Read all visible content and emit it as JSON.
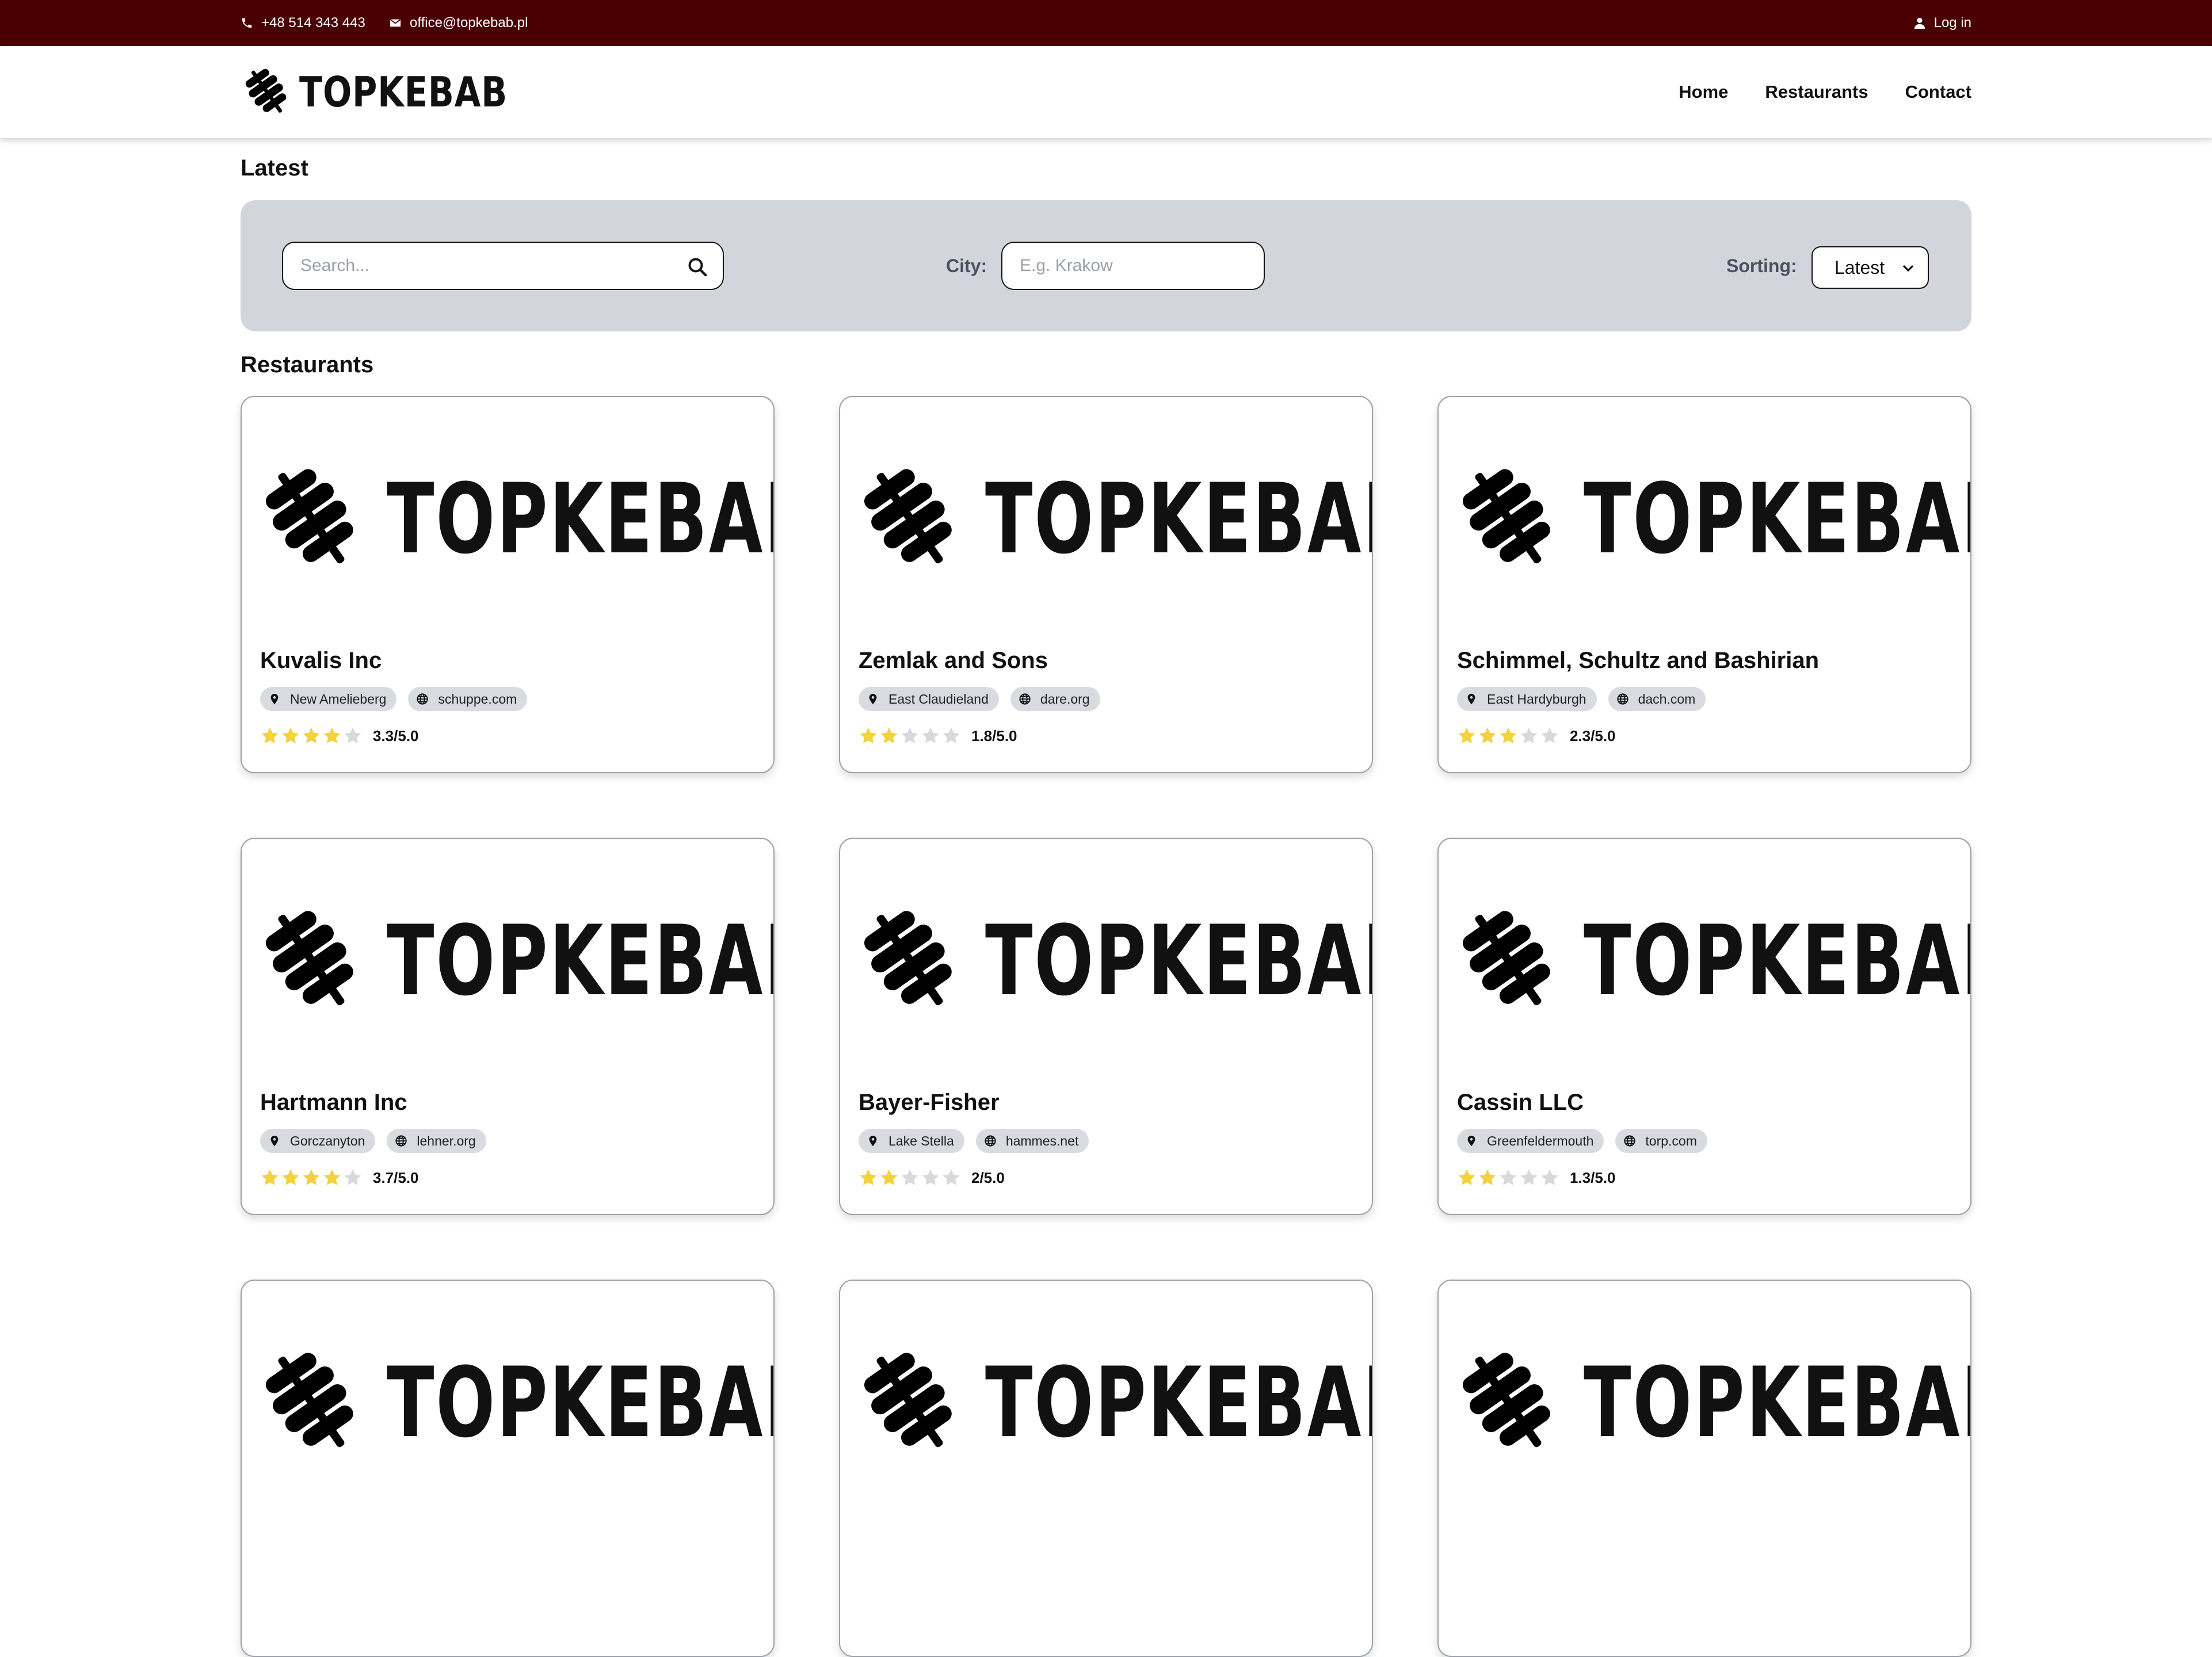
{
  "topbar": {
    "phone": "+48 514 343 443",
    "email": "office@topkebab.pl",
    "login": "Log in"
  },
  "brand": {
    "name": "TOPKEBAB"
  },
  "nav": {
    "home": "Home",
    "restaurants": "Restaurants",
    "contact": "Contact"
  },
  "headings": {
    "latest": "Latest",
    "restaurants": "Restaurants"
  },
  "filters": {
    "search_placeholder": "Search...",
    "city_label": "City:",
    "city_placeholder": "E.g. Krakow",
    "sorting_label": "Sorting:",
    "sorting_value": "Latest"
  },
  "colors": {
    "topbar": "#4a0003",
    "star_on": "#f2d33b",
    "star_off": "#d7d9dd",
    "filter_bg": "#d2d5dc"
  },
  "restaurants": [
    {
      "name": "Kuvalis Inc",
      "city": "New Amelieberg",
      "site": "schuppe.com",
      "stars": 4,
      "score": "3.3/5.0"
    },
    {
      "name": "Zemlak and Sons",
      "city": "East Claudieland",
      "site": "dare.org",
      "stars": 2,
      "score": "1.8/5.0"
    },
    {
      "name": "Schimmel, Schultz and Bashirian",
      "city": "East Hardyburgh",
      "site": "dach.com",
      "stars": 3,
      "score": "2.3/5.0"
    },
    {
      "name": "Hartmann Inc",
      "city": "Gorczanyton",
      "site": "lehner.org",
      "stars": 4,
      "score": "3.7/5.0"
    },
    {
      "name": "Bayer-Fisher",
      "city": "Lake Stella",
      "site": "hammes.net",
      "stars": 2,
      "score": "2/5.0"
    },
    {
      "name": "Cassin LLC",
      "city": "Greenfeldermouth",
      "site": "torp.com",
      "stars": 2,
      "score": "1.3/5.0"
    },
    {
      "name": "",
      "city": "",
      "site": "",
      "stars": 0,
      "score": ""
    },
    {
      "name": "",
      "city": "",
      "site": "",
      "stars": 0,
      "score": ""
    },
    {
      "name": "",
      "city": "",
      "site": "",
      "stars": 0,
      "score": ""
    }
  ]
}
